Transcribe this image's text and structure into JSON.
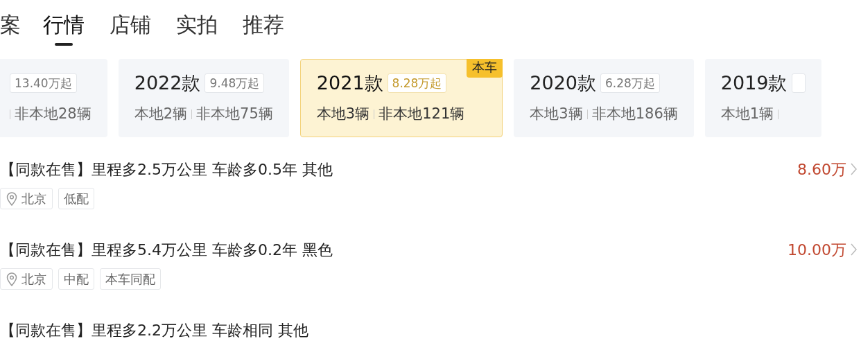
{
  "tabs": [
    {
      "label": "案",
      "selected": false
    },
    {
      "label": "行情",
      "selected": true
    },
    {
      "label": "店铺",
      "selected": false
    },
    {
      "label": "实拍",
      "selected": false
    },
    {
      "label": "推荐",
      "selected": false
    }
  ],
  "year_cards": [
    {
      "price": "13.40万起",
      "nonlocal": "非本地28辆",
      "selected": false
    },
    {
      "year": "2022款",
      "price": "9.48万起",
      "local": "本地2辆",
      "nonlocal": "非本地75辆",
      "selected": false
    },
    {
      "year": "2021款",
      "price": "8.28万起",
      "local": "本地3辆",
      "nonlocal": "非本地121辆",
      "selected": true,
      "badge": "本车"
    },
    {
      "year": "2020款",
      "price": "6.28万起",
      "local": "本地3辆",
      "nonlocal": "非本地186辆",
      "selected": false
    },
    {
      "year": "2019款",
      "local": "本地1辆",
      "selected": false
    }
  ],
  "listings": [
    {
      "title": "【同款在售】里程多2.5万公里 车龄多0.5年 其他",
      "price": "8.60万",
      "location": "北京",
      "tags": [
        "低配"
      ]
    },
    {
      "title": "【同款在售】里程多5.4万公里 车龄多0.2年 黑色",
      "price": "10.00万",
      "location": "北京",
      "tags": [
        "中配",
        "本车同配"
      ]
    },
    {
      "title": "【同款在售】里程多2.2万公里 车龄相同 其他"
    }
  ]
}
